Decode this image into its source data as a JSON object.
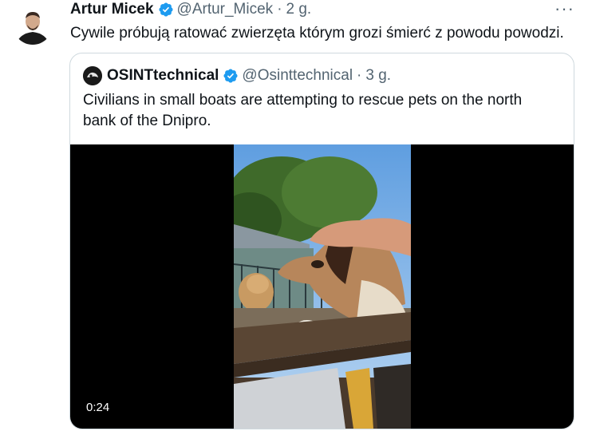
{
  "tweet": {
    "author_name": "Artur Micek",
    "handle": "@Artur_Micek",
    "separator": "·",
    "time": "2 g.",
    "more_icon": "more-horizontal-icon",
    "more_glyph": "···",
    "text": "Cywile próbują ratować zwierzęta którym grozi śmierć z powodu powodzi."
  },
  "quote": {
    "author_name": "OSINTtechnical",
    "handle": "@Osinttechnical",
    "separator": "·",
    "time": "3 g.",
    "text": "Civilians in small boats are attempting to rescue pets on the north bank of the Dnipro.",
    "video": {
      "duration": "0:24"
    }
  },
  "colors": {
    "verified_blue": "#1d9bf0",
    "text_primary": "#0f1419",
    "text_secondary": "#536471",
    "border": "#cfd9de"
  }
}
